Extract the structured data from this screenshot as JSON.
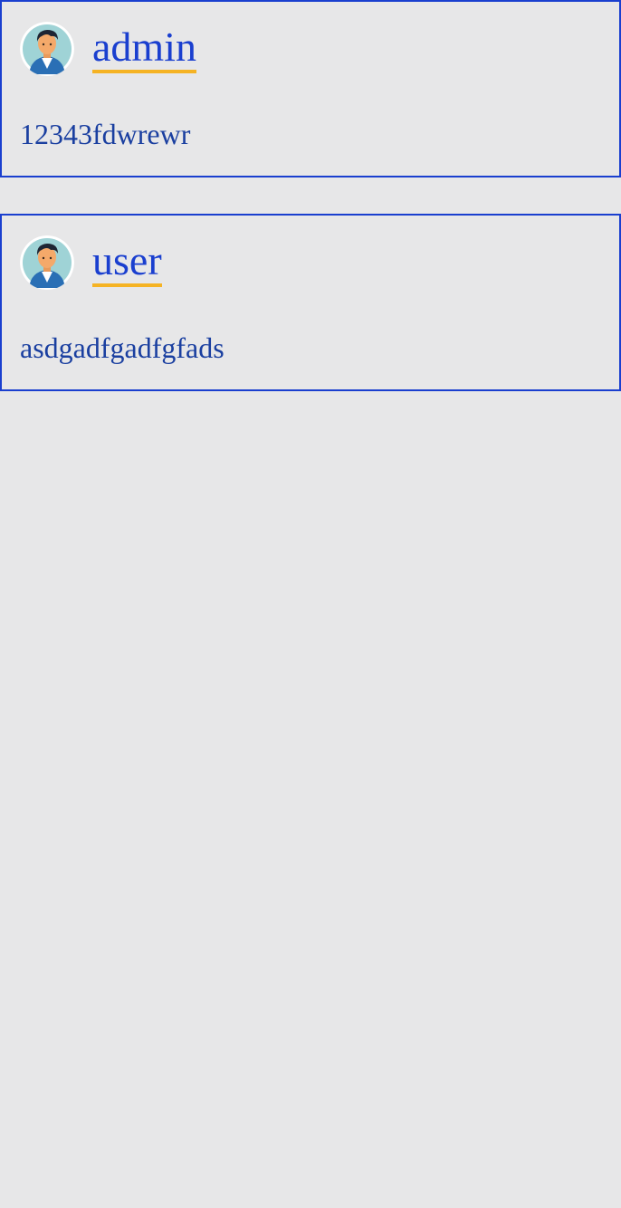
{
  "colors": {
    "background": "#e7e7e8",
    "card_border": "#1a3fcf",
    "name_text": "#1a3fcf",
    "name_underline": "#f5b324",
    "message_text": "#1a3fa0"
  },
  "posts": [
    {
      "username": "admin",
      "message": "12343fdwrewr",
      "avatar_icon": "user-avatar-icon"
    },
    {
      "username": "user",
      "message": "asdgadfgadfgfads",
      "avatar_icon": "user-avatar-icon"
    }
  ]
}
